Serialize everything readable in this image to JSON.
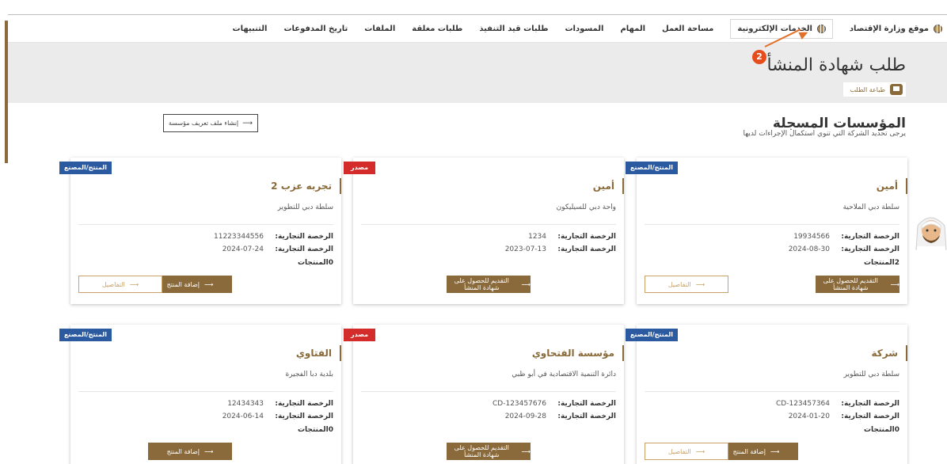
{
  "nav": {
    "items": [
      {
        "label": "موقع وزارة الإقتصاد",
        "icon": "globe-icon"
      },
      {
        "label": "الخدمات الإلكترونية",
        "icon": "globe-icon"
      },
      {
        "label": "مساحة العمل"
      },
      {
        "label": "المهام"
      },
      {
        "label": "المسودات"
      },
      {
        "label": "طلبات قيد التنفيذ"
      },
      {
        "label": "طلبات مغلقة"
      },
      {
        "label": "الملفات"
      },
      {
        "label": "تاريخ المدفوعات"
      },
      {
        "label": "التنبيهات"
      }
    ]
  },
  "page": {
    "title": "طلب شهادة المنشأ",
    "print_label": "طباعة الطلب",
    "step_badge": "2"
  },
  "section": {
    "title": "المؤسسات المسجلة",
    "subtitle": "يرجى تحديد الشركة التي تنوي استكمال الإجراءات لديها",
    "create_label": "إنشاء ملف تعريف مؤسسة"
  },
  "labels": {
    "license": "الرخصة التجارية:",
    "products_suffix": "المنتجات",
    "add_product": "إضافة المنتج",
    "apply": "التقديم للحصول على شهادة المنشأ",
    "details": "التفاصيل",
    "arrow": "⟶"
  },
  "cards": [
    {
      "ribbon": "المنتج/المصنع",
      "ribbon_color": "#2c5aa0",
      "name": "أمين",
      "authority": "سلطة دبي الملاحية",
      "license_no": "19934566",
      "license_date": "2024-08-30",
      "products": "2المنتجات"
    },
    {
      "ribbon": "مصدر",
      "ribbon_color": "#d42b2b",
      "name": "أمين",
      "authority": "واحة دبي للسيليكون",
      "license_no": "1234",
      "license_date": "2023-07-13",
      "products": ""
    },
    {
      "ribbon": "المنتج/المصنع",
      "ribbon_color": "#2c5aa0",
      "name": "تجربه عزب 2",
      "authority": "سلطة دبي للتطوير",
      "license_no": "11223344556",
      "license_date": "2024-07-24",
      "products": "0المنتجات"
    },
    {
      "ribbon": "المنتج/المصنع",
      "ribbon_color": "#2c5aa0",
      "name": "شركة",
      "authority": "سلطة دبي للتطوير",
      "license_no": "CD-123457364",
      "license_date": "2024-01-20",
      "products": "0المنتجات"
    },
    {
      "ribbon": "مصدر",
      "ribbon_color": "#d42b2b",
      "name": "مؤسسة الفتحاوي",
      "authority": "دائرة التنمية الاقتصادية في أبو ظبي",
      "license_no": "CD-123457676",
      "license_date": "2024-09-28",
      "products": ""
    },
    {
      "ribbon": "المنتج/المصنع",
      "ribbon_color": "#2c5aa0",
      "name": "الفتاوي",
      "authority": "بلدية دبا الفجيرة",
      "license_no": "12434343",
      "license_date": "2024-06-14",
      "products": "0المنتجات"
    }
  ],
  "colors": {
    "accent": "#8a6a3a",
    "producer_ribbon": "#2c5aa0",
    "exporter_ribbon": "#d42b2b"
  }
}
